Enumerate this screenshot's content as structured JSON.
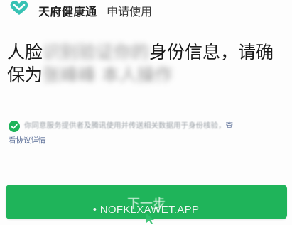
{
  "header": {
    "app_name": "天府健康通",
    "action": "申请使用"
  },
  "heading": {
    "line1_start": "人脸",
    "line1_blurred": "识别验证你的",
    "line1_end": "身份信息，请确",
    "line2_start": "保为",
    "line2_blurred": "张峰峰 本人操作"
  },
  "consent": {
    "checked": true,
    "text": "你同意服务提供者及腾讯使用并传送相关数据用于身份核验，",
    "link_part1": "查",
    "link_part2": "看协议详情"
  },
  "next_button": {
    "label": "下一步"
  },
  "watermark": {
    "text": "• NOFKLXAWET.APP"
  },
  "colors": {
    "brand_green": "#1fb45a",
    "logo_teal": "#37c2b4",
    "link_blue": "#576b95"
  }
}
